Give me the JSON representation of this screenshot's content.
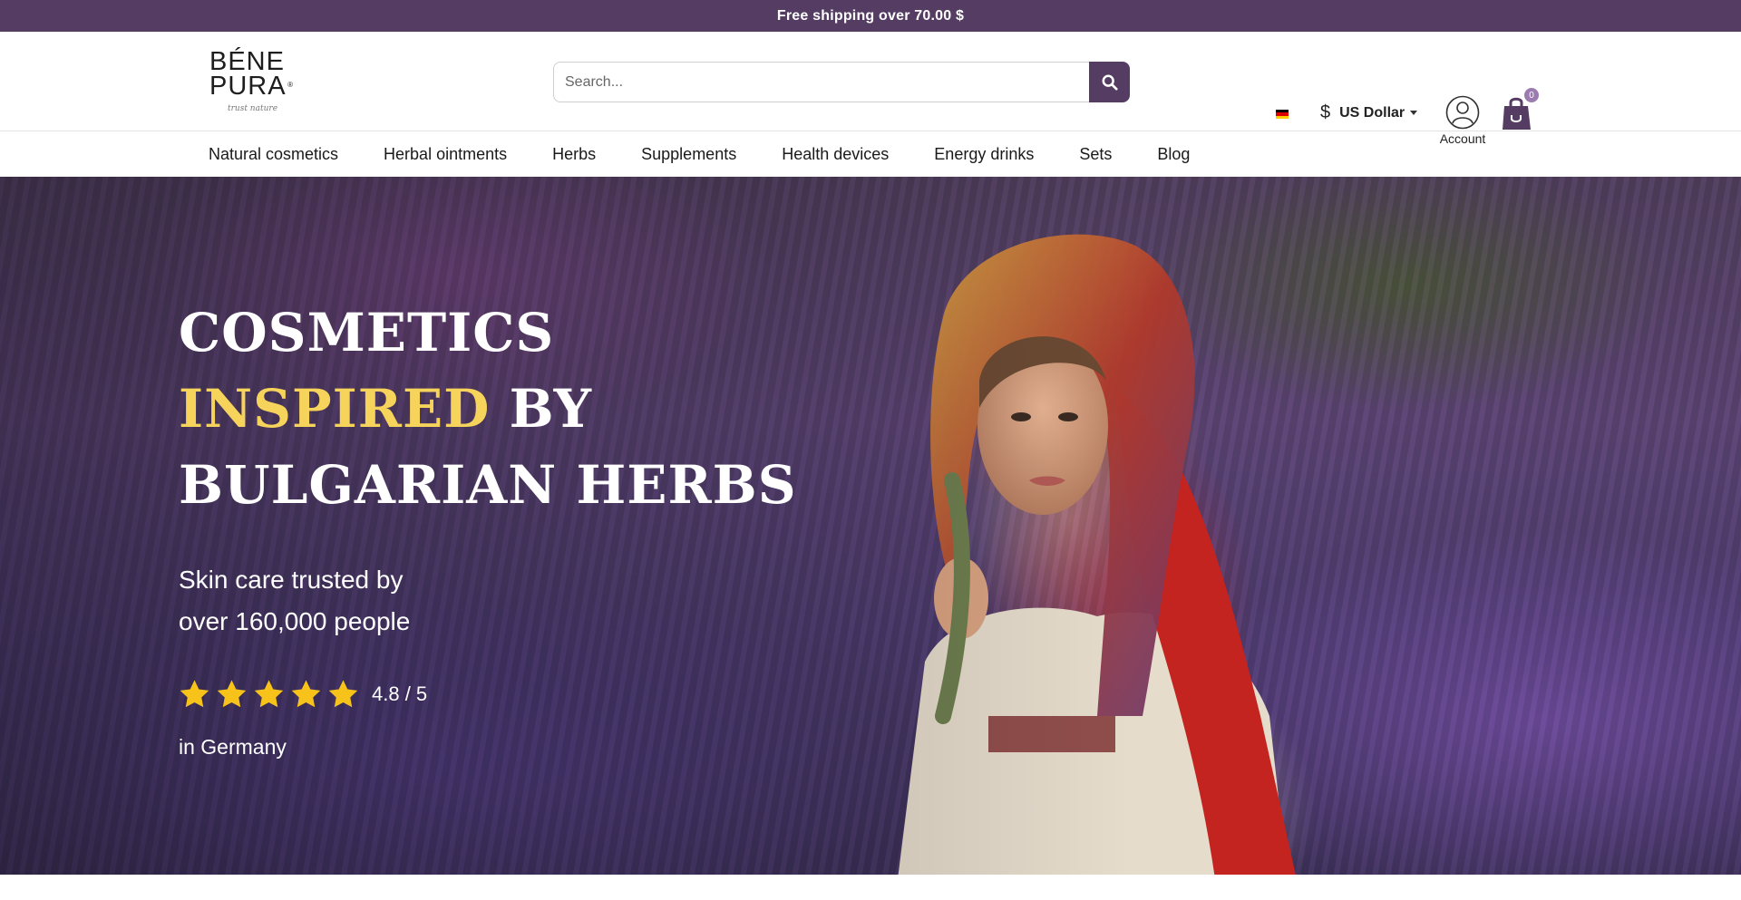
{
  "topbar": {
    "text": "Free shipping over 70.00 $"
  },
  "header": {
    "logo": {
      "line1": "BÉNE",
      "line2": "PURA",
      "tagline": "trust nature",
      "reg": "®"
    },
    "search": {
      "placeholder": "Search..."
    },
    "currency": {
      "symbol": "$",
      "label": "US Dollar"
    },
    "account": {
      "label": "Account"
    },
    "cart": {
      "count": "0"
    },
    "flag_colors": [
      "#000000",
      "#dd0000",
      "#ffce00"
    ]
  },
  "nav": {
    "items": [
      {
        "label": "Natural cosmetics"
      },
      {
        "label": "Herbal ointments"
      },
      {
        "label": "Herbs"
      },
      {
        "label": "Supplements"
      },
      {
        "label": "Health devices"
      },
      {
        "label": "Energy drinks"
      },
      {
        "label": "Sets"
      },
      {
        "label": "Blog"
      }
    ]
  },
  "hero": {
    "line1": "COSMETICS",
    "line2_highlight": "INSPIRED",
    "line2_rest": " BY",
    "line3": "BULGARIAN HERBS",
    "sub1": "Skin care trusted by",
    "sub2": "over 160,000 people",
    "rating": {
      "score": "4.8 / 5",
      "stars": 5
    },
    "region": "in Germany"
  },
  "colors": {
    "brand": "#553c63",
    "highlight": "#f6d35a",
    "star": "#f7c31b"
  }
}
